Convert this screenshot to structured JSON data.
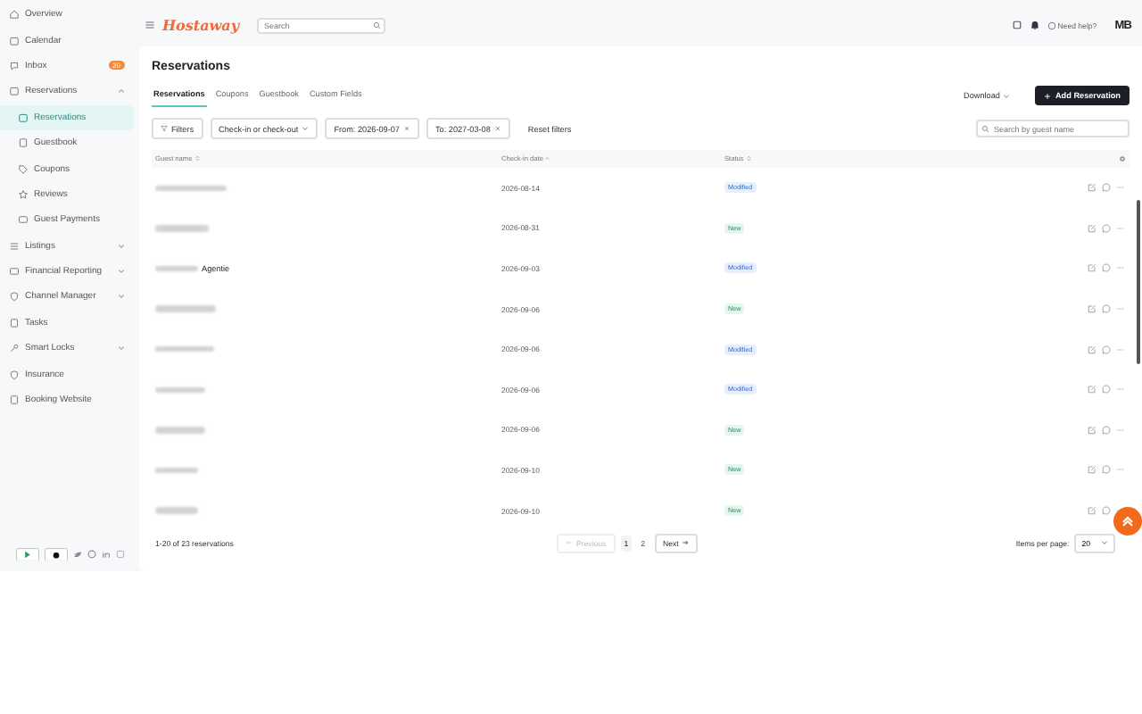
{
  "sidebar": {
    "items": [
      {
        "label": "Overview",
        "selected": false
      },
      {
        "label": "Calendar",
        "selected": false
      },
      {
        "label": "Inbox",
        "selected": false,
        "badge": "20"
      },
      {
        "label": "Reservations",
        "selected": false,
        "expanded": true,
        "children": [
          {
            "label": "Reservations",
            "selected": true
          },
          {
            "label": "Guestbook",
            "selected": false
          },
          {
            "label": "Coupons",
            "selected": false
          },
          {
            "label": "Reviews",
            "selected": false
          },
          {
            "label": "Guest Payments",
            "selected": false
          }
        ]
      },
      {
        "label": "Listings",
        "selected": false,
        "expanded": false
      },
      {
        "label": "Financial Reporting",
        "selected": false,
        "expanded": false
      },
      {
        "label": "Channel Manager",
        "selected": false,
        "expanded": false
      },
      {
        "label": "Tasks",
        "selected": false
      },
      {
        "label": "Smart Locks",
        "selected": false,
        "expanded": false
      },
      {
        "label": "Insurance",
        "selected": false
      },
      {
        "label": "Booking Website",
        "selected": false
      }
    ]
  },
  "topbar": {
    "logo": "Hostaway",
    "search": {
      "placeholder": "Search"
    },
    "help": "Need help?",
    "user": "MB"
  },
  "page": {
    "title": "Reservations",
    "tabs": [
      {
        "label": "Reservations",
        "selected": true
      },
      {
        "label": "Coupons",
        "selected": false
      },
      {
        "label": "Guestbook",
        "selected": false
      },
      {
        "label": "Custom Fields",
        "selected": false
      }
    ],
    "download": "Download",
    "add_button": "Add Reservation",
    "filters": {
      "filters_button": "Filters",
      "date_type": "Check-in or check-out",
      "from": "From: 2026-09-07",
      "to": "To: 2027-03-08",
      "reset": "Reset filters",
      "search": {
        "placeholder": "Search by guest name"
      }
    }
  },
  "table": {
    "columns": [
      "Guest name",
      "Check-in date",
      "Status"
    ],
    "rows": [
      {
        "guest_name_blurred": true,
        "check_in": "2026-08-14",
        "status": "Modified"
      },
      {
        "guest_name_blurred": true,
        "check_in": "2026-08-31",
        "status": "New"
      },
      {
        "guest_name_blurred": true,
        "guest_name": "Agentie",
        "check_in": "2026-09-03",
        "status": "Modified"
      },
      {
        "guest_name_blurred": true,
        "check_in": "2026-09-06",
        "status": "New"
      },
      {
        "guest_name_blurred": true,
        "check_in": "2026-09-06",
        "status": "Modified"
      },
      {
        "guest_name_blurred": true,
        "check_in": "2026-09-06",
        "status": "Modified"
      },
      {
        "guest_name_blurred": true,
        "check_in": "2026-09-06",
        "status": "New"
      },
      {
        "guest_name_blurred": true,
        "check_in": "2026-09-10",
        "status": "New"
      },
      {
        "guest_name_blurred": true,
        "check_in": "2026-09-10",
        "status": "New"
      }
    ]
  },
  "pagination": {
    "summary": "1-20 of 23 reservations",
    "previous": "Previous",
    "pages": [
      {
        "label": "1",
        "selected": true
      },
      {
        "label": "2",
        "selected": false
      }
    ],
    "next": "Next",
    "items_per_page_label": "Items per page:",
    "items_per_page": "20"
  }
}
